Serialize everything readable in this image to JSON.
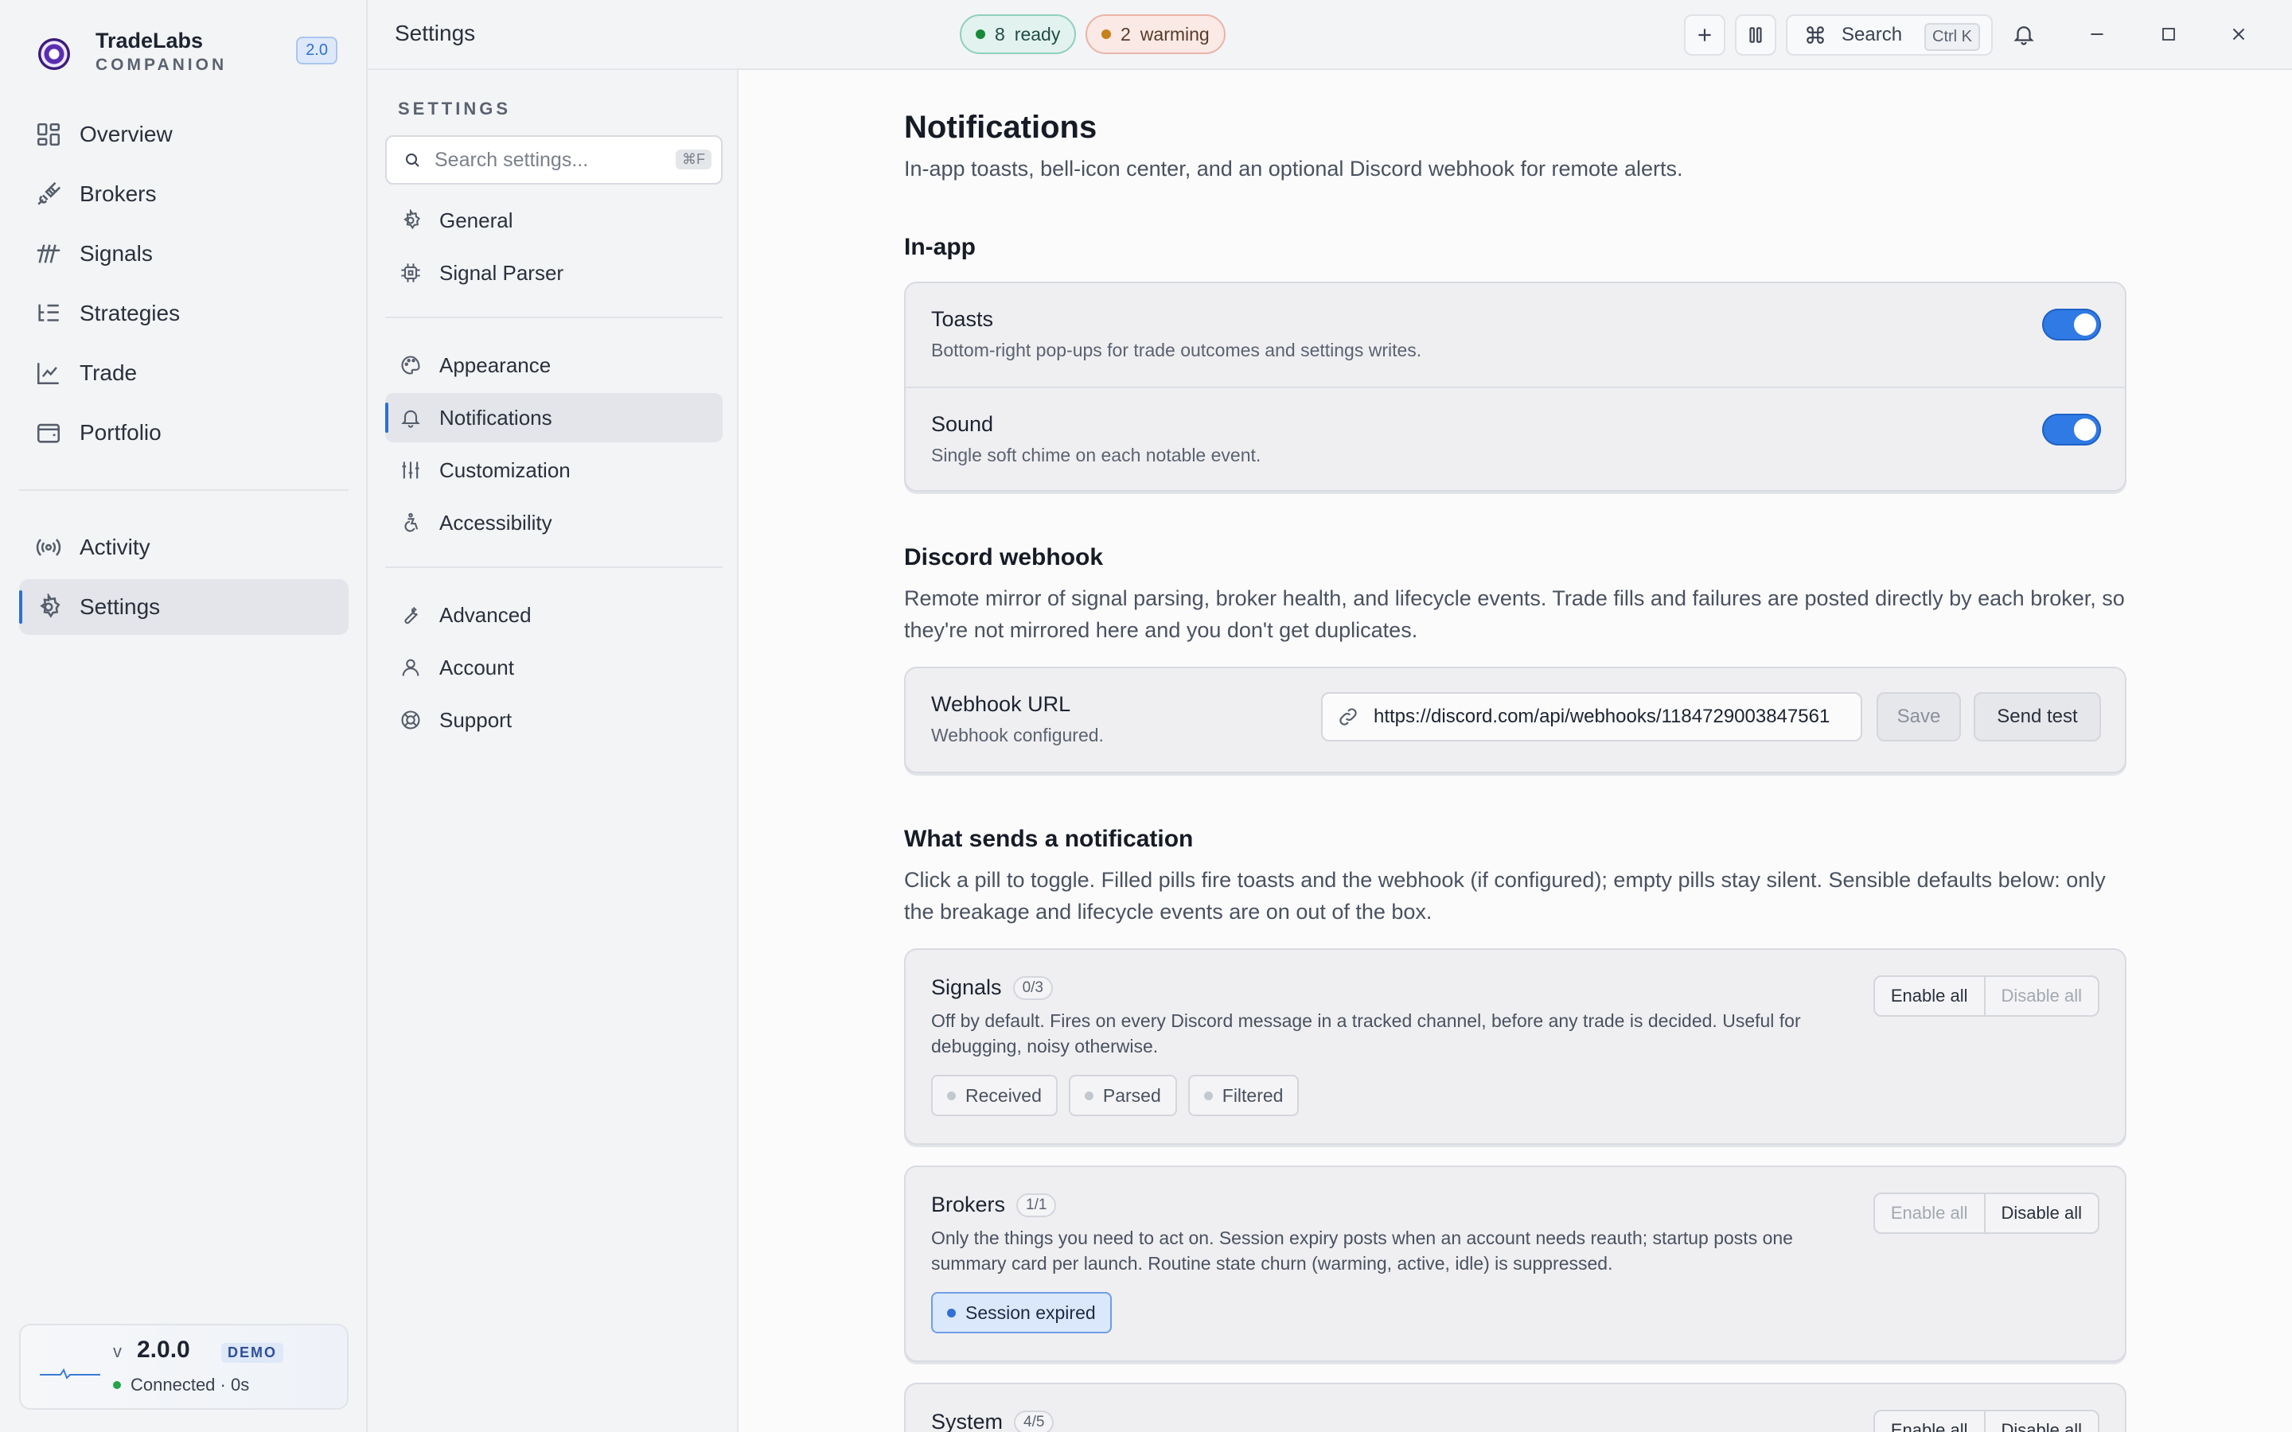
{
  "app": {
    "name": "TradeLabs",
    "subtitle": "COMPANION",
    "version_badge": "2.0"
  },
  "nav": {
    "items": [
      {
        "label": "Overview",
        "icon": "grid-icon"
      },
      {
        "label": "Brokers",
        "icon": "plug-icon"
      },
      {
        "label": "Signals",
        "icon": "signal-bars-icon"
      },
      {
        "label": "Strategies",
        "icon": "list-tree-icon"
      },
      {
        "label": "Trade",
        "icon": "chart-line-icon"
      },
      {
        "label": "Portfolio",
        "icon": "wallet-icon"
      }
    ],
    "secondary": [
      {
        "label": "Activity",
        "icon": "broadcast-icon"
      },
      {
        "label": "Settings",
        "icon": "gear-icon",
        "active": true
      }
    ]
  },
  "status": {
    "v_prefix": "v",
    "version": "2.0.0",
    "badge": "DEMO",
    "connection": "Connected · 0s"
  },
  "topbar": {
    "title": "Settings",
    "ready_count": "8",
    "ready_label": "ready",
    "warming_count": "2",
    "warming_label": "warming",
    "search_label": "Search",
    "search_shortcut": "Ctrl K"
  },
  "subnav": {
    "heading": "SETTINGS",
    "search_placeholder": "Search settings...",
    "search_shortcut": "⌘F",
    "groups": [
      [
        {
          "label": "General",
          "icon": "gear-icon"
        },
        {
          "label": "Signal Parser",
          "icon": "chip-icon"
        }
      ],
      [
        {
          "label": "Appearance",
          "icon": "palette-icon"
        },
        {
          "label": "Notifications",
          "icon": "bell-icon",
          "active": true
        },
        {
          "label": "Customization",
          "icon": "sliders-icon"
        },
        {
          "label": "Accessibility",
          "icon": "accessibility-icon"
        }
      ],
      [
        {
          "label": "Advanced",
          "icon": "wrench-icon"
        },
        {
          "label": "Account",
          "icon": "user-icon"
        },
        {
          "label": "Support",
          "icon": "lifebuoy-icon"
        }
      ]
    ]
  },
  "page": {
    "title": "Notifications",
    "description": "In-app toasts, bell-icon center, and an optional Discord webhook for remote alerts.",
    "inapp": {
      "title": "In-app",
      "rows": [
        {
          "label": "Toasts",
          "hint": "Bottom-right pop-ups for trade outcomes and settings writes.",
          "enabled": true
        },
        {
          "label": "Sound",
          "hint": "Single soft chime on each notable event.",
          "enabled": true
        }
      ]
    },
    "webhook": {
      "title": "Discord webhook",
      "description": "Remote mirror of signal parsing, broker health, and lifecycle events. Trade fills and failures are posted directly by each broker, so they're not mirrored here and you don't get duplicates.",
      "label": "Webhook URL",
      "hint": "Webhook configured.",
      "url": "https://discord.com/api/webhooks/1184729003847561",
      "save_label": "Save",
      "test_label": "Send test"
    },
    "events": {
      "title": "What sends a notification",
      "description": "Click a pill to toggle. Filled pills fire toasts and the webhook (if configured); empty pills stay silent. Sensible defaults below: only the breakage and lifecycle events are on out of the box.",
      "enable_all": "Enable all",
      "disable_all": "Disable all",
      "groups": [
        {
          "name": "Signals",
          "count": "0/3",
          "description": "Off by default. Fires on every Discord message in a tracked channel, before any trade is decided. Useful for debugging, noisy otherwise.",
          "chips": [
            {
              "label": "Received",
              "on": false
            },
            {
              "label": "Parsed",
              "on": false
            },
            {
              "label": "Filtered",
              "on": false
            }
          ]
        },
        {
          "name": "Brokers",
          "count": "1/1",
          "description": "Only the things you need to act on. Session expiry posts when an account needs reauth; startup posts one summary card per launch. Routine state churn (warming, active, idle) is suppressed.",
          "chips": [
            {
              "label": "Session expired",
              "on": true
            }
          ]
        },
        {
          "name": "System",
          "count": "4/5",
          "description": "",
          "chips": []
        }
      ]
    }
  }
}
